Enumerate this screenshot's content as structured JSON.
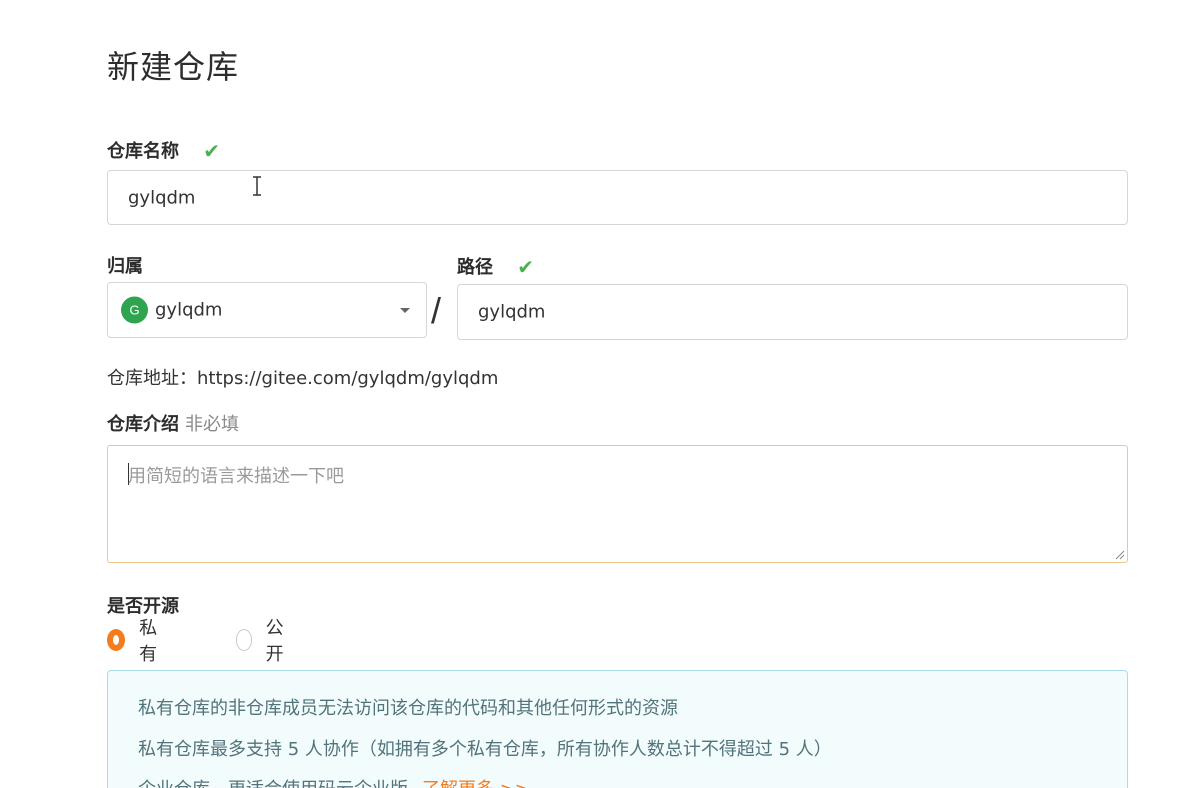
{
  "page": {
    "title": "新建仓库"
  },
  "repo_name": {
    "label": "仓库名称",
    "value": "gylqdm",
    "valid_icon": "check-icon"
  },
  "owner": {
    "label": "归属",
    "avatar_letter": "G",
    "value": "gylqdm",
    "avatar_color": "#2ea44f"
  },
  "path": {
    "label": "路径",
    "separator": "/",
    "value": "gylqdm",
    "valid_icon": "check-icon"
  },
  "address": {
    "text": "仓库地址：https://gitee.com/gylqdm/gylqdm"
  },
  "description": {
    "label": "仓库介绍",
    "optional_tag": "非必填",
    "placeholder": "用简短的语言来描述一下吧"
  },
  "visibility": {
    "label": "是否开源",
    "options": [
      {
        "label": "私有",
        "selected": true
      },
      {
        "label": "公开",
        "selected": false
      }
    ],
    "accent_color": "#f57c1c"
  },
  "notice": {
    "line1": "私有仓库的非仓库成员无法访问该仓库的代码和其他任何形式的资源",
    "line2": "私有仓库最多支持 5 人协作（如拥有多个私有仓库，所有协作人数总计不得超过 5 人）",
    "line3": "企业仓库，更适合使用码云企业版",
    "link": "了解更多 >>"
  },
  "colors": {
    "valid": "#4caf50",
    "focus_border": "#f0c78a",
    "notice_bg": "#f2fcfd",
    "notice_border": "#a9dde5"
  }
}
